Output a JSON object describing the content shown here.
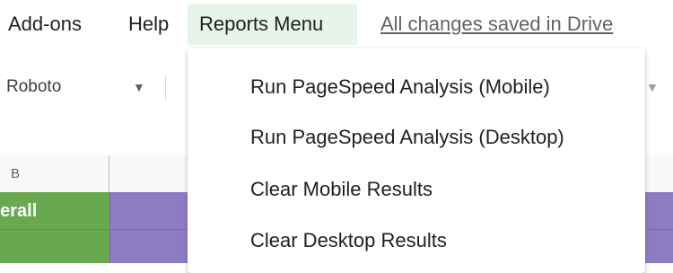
{
  "menubar": {
    "items": [
      {
        "label": "Add-ons"
      },
      {
        "label": "Help"
      },
      {
        "label": "Reports Menu"
      }
    ],
    "status_link": "All changes saved in Drive"
  },
  "toolbar": {
    "font_name": "Roboto",
    "font_dropdown_icon": "caret-down-icon"
  },
  "sheet": {
    "column_headers": [
      "B",
      ""
    ],
    "cell_b1": "verall"
  },
  "dropdown": {
    "items": [
      {
        "label": "Run PageSpeed Analysis (Mobile)"
      },
      {
        "label": "Run PageSpeed Analysis (Desktop)"
      },
      {
        "label": "Clear Mobile Results"
      },
      {
        "label": "Clear Desktop Results"
      }
    ]
  },
  "colors": {
    "reports_menu_active_bg": "#e6f4ea",
    "green_cell": "#6aa84f",
    "purple_cell": "#8e7cc3"
  }
}
